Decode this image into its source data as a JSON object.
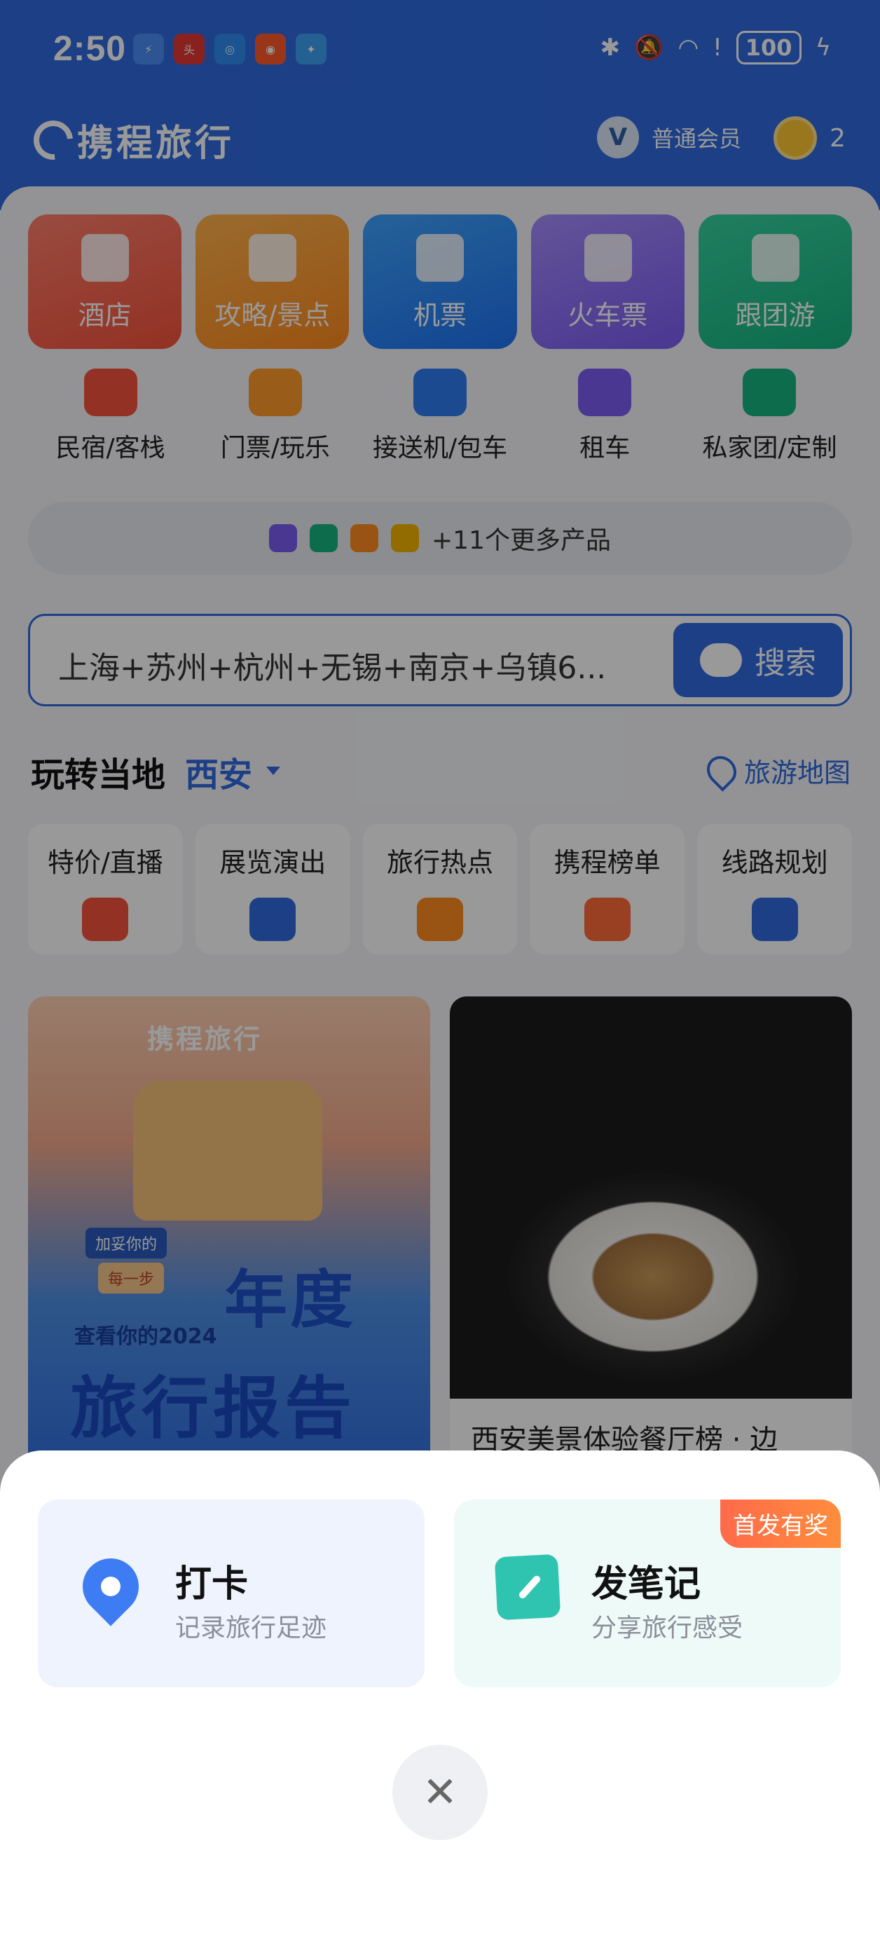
{
  "status_bar": {
    "time": "2:50",
    "battery": "100"
  },
  "header": {
    "logo": "携程旅行",
    "member_label": "普通会员",
    "member_icon": "V",
    "points": "2"
  },
  "big_tiles": [
    {
      "label": "酒店",
      "icon": "hotel-icon"
    },
    {
      "label": "攻略/景点",
      "icon": "book-icon"
    },
    {
      "label": "机票",
      "icon": "plane-icon"
    },
    {
      "label": "火车票",
      "icon": "train-icon"
    },
    {
      "label": "跟团游",
      "icon": "palm-icon"
    }
  ],
  "small_tiles": [
    {
      "label": "民宿/客栈",
      "icon": "house-icon"
    },
    {
      "label": "门票/玩乐",
      "icon": "ticket-icon"
    },
    {
      "label": "接送机/包车",
      "icon": "car-plane-icon"
    },
    {
      "label": "租车",
      "icon": "car-icon"
    },
    {
      "label": "私家团/定制",
      "icon": "diamond-icon"
    }
  ],
  "more_products": "+11个更多产品",
  "search": {
    "placeholder": "上海+苏州+杭州+无锡+南京+乌镇6...",
    "button": "搜索"
  },
  "local": {
    "title": "玩转当地",
    "city": "西安",
    "map_link": "旅游地图"
  },
  "categories": [
    {
      "label": "特价/直播",
      "icon": "tag-icon"
    },
    {
      "label": "展览演出",
      "icon": "music-icon"
    },
    {
      "label": "旅行热点",
      "icon": "map-fold-icon"
    },
    {
      "label": "携程榜单",
      "icon": "rank-icon"
    },
    {
      "label": "线路规划",
      "icon": "route-icon"
    }
  ],
  "feed": {
    "card1": {
      "brand": "携程旅行",
      "sign1": "加妥你的",
      "sign2": "每一步",
      "small": "查看你的2024",
      "big1": "年度",
      "big2": "旅行报告"
    },
    "card2": {
      "caption": "西安美景体验餐厅榜 · 边"
    }
  },
  "sheet": {
    "checkin": {
      "title": "打卡",
      "subtitle": "记录旅行足迹"
    },
    "note": {
      "title": "发笔记",
      "subtitle": "分享旅行感受",
      "badge": "首发有奖"
    },
    "close": "✕"
  }
}
